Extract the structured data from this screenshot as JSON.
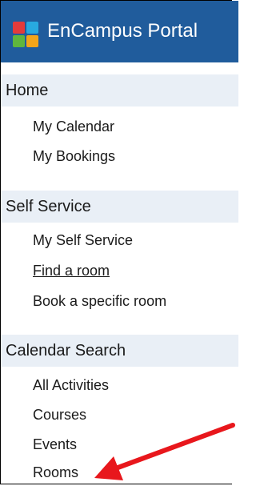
{
  "app": {
    "title": "EnCampus Portal",
    "logo_icon": "four-squares-logo-icon",
    "logo_colors": [
      "#e33b3b",
      "#28a9e0",
      "#5fb63d",
      "#f3a51a"
    ],
    "title_bar_color": "#205c9c"
  },
  "sections": [
    {
      "label": "Home",
      "items": [
        "My Calendar",
        "My Bookings"
      ]
    },
    {
      "label": "Self Service",
      "items": [
        "My Self Service",
        "Find a room",
        "Book a specific room"
      ]
    },
    {
      "label": "Calendar Search",
      "items": [
        "All Activities",
        "Courses",
        "Events",
        "Rooms"
      ]
    }
  ],
  "annotation": {
    "icon": "red-arrow-icon",
    "color": "#e8171c",
    "target": "Rooms"
  }
}
